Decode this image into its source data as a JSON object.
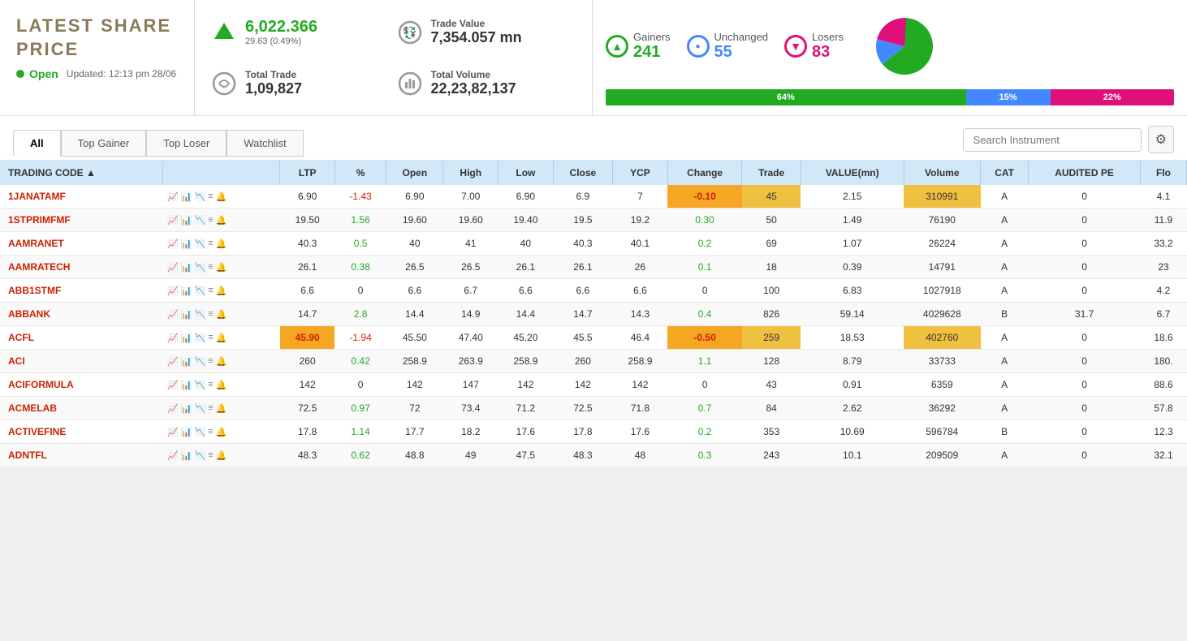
{
  "header": {
    "title": "LATEST SHARE PRICE",
    "status": "Open",
    "updated": "Updated: 12:13 pm 28/06"
  },
  "index": {
    "value": "6,022.366",
    "change": "29.63 (0.49%)",
    "trade_label": "Total Trade",
    "trade_value": "1,09,827",
    "trade_value_label": "Trade Value",
    "trade_value_mn": "7,354.057 mn",
    "volume_label": "Total Volume",
    "volume_value": "22,23,82,137"
  },
  "stats": {
    "gainers_label": "Gainers",
    "gainers_value": "241",
    "unchanged_label": "Unchanged",
    "unchanged_value": "55",
    "losers_label": "Losers",
    "losers_value": "83",
    "bar_green_pct": "64%",
    "bar_green_width": "64",
    "bar_blue_pct": "15%",
    "bar_blue_width": "15",
    "bar_pink_pct": "22%",
    "bar_pink_width": "22"
  },
  "tabs": [
    "All",
    "Top Gainer",
    "Top Loser",
    "Watchlist"
  ],
  "active_tab": 0,
  "search_placeholder": "Search Instrument",
  "table": {
    "columns": [
      "TRADING CODE ▲",
      "",
      "LTP",
      "%",
      "Open",
      "High",
      "Low",
      "Close",
      "YCP",
      "Change",
      "Trade",
      "VALUE(mn)",
      "Volume",
      "CAT",
      "AUDITED PE",
      "Flo"
    ],
    "rows": [
      {
        "code": "1JANATAMF",
        "ltp": "6.90",
        "pct": "-1.43",
        "open": "6.90",
        "high": "7.00",
        "low": "6.90",
        "close": "6.9",
        "ycp": "7",
        "change": "-0.10",
        "trade": "45",
        "value": "2.15",
        "volume": "310991",
        "cat": "A",
        "pe": "0",
        "flo": "4.1",
        "pct_neg": true,
        "change_neg": true,
        "highlight_change": true,
        "highlight_trade": true,
        "highlight_volume": true
      },
      {
        "code": "1STPRIMFMF",
        "ltp": "19.50",
        "pct": "1.56",
        "open": "19.60",
        "high": "19.60",
        "low": "19.40",
        "close": "19.5",
        "ycp": "19.2",
        "change": "0.30",
        "trade": "50",
        "value": "1.49",
        "volume": "76190",
        "cat": "A",
        "pe": "0",
        "flo": "11.9",
        "pct_neg": false,
        "change_neg": false
      },
      {
        "code": "AAMRANET",
        "ltp": "40.3",
        "pct": "0.5",
        "open": "40",
        "high": "41",
        "low": "40",
        "close": "40.3",
        "ycp": "40.1",
        "change": "0.2",
        "trade": "69",
        "value": "1.07",
        "volume": "26224",
        "cat": "A",
        "pe": "0",
        "flo": "33.2",
        "pct_neg": false,
        "change_neg": false
      },
      {
        "code": "AAMRATECH",
        "ltp": "26.1",
        "pct": "0.38",
        "open": "26.5",
        "high": "26.5",
        "low": "26.1",
        "close": "26.1",
        "ycp": "26",
        "change": "0.1",
        "trade": "18",
        "value": "0.39",
        "volume": "14791",
        "cat": "A",
        "pe": "0",
        "flo": "23",
        "pct_neg": false,
        "change_neg": false
      },
      {
        "code": "ABB1STMF",
        "ltp": "6.6",
        "pct": "0",
        "open": "6.6",
        "high": "6.7",
        "low": "6.6",
        "close": "6.6",
        "ycp": "6.6",
        "change": "0",
        "trade": "100",
        "value": "6.83",
        "volume": "1027918",
        "cat": "A",
        "pe": "0",
        "flo": "4.2",
        "pct_neg": false,
        "change_neg": false
      },
      {
        "code": "ABBANK",
        "ltp": "14.7",
        "pct": "2.8",
        "open": "14.4",
        "high": "14.9",
        "low": "14.4",
        "close": "14.7",
        "ycp": "14.3",
        "change": "0.4",
        "trade": "826",
        "value": "59.14",
        "volume": "4029628",
        "cat": "B",
        "pe": "31.7",
        "flo": "6.7",
        "pct_neg": false,
        "change_neg": false
      },
      {
        "code": "ACFL",
        "ltp": "45.90",
        "pct": "-1.94",
        "open": "45.50",
        "high": "47.40",
        "low": "45.20",
        "close": "45.5",
        "ycp": "46.4",
        "change": "-0.50",
        "trade": "259",
        "value": "18.53",
        "volume": "402760",
        "cat": "A",
        "pe": "0",
        "flo": "18.6",
        "pct_neg": true,
        "change_neg": true,
        "highlight_ltp": true,
        "highlight_change": true,
        "highlight_trade": true,
        "highlight_volume": true
      },
      {
        "code": "ACI",
        "ltp": "260",
        "pct": "0.42",
        "open": "258.9",
        "high": "263.9",
        "low": "258.9",
        "close": "260",
        "ycp": "258.9",
        "change": "1.1",
        "trade": "128",
        "value": "8.79",
        "volume": "33733",
        "cat": "A",
        "pe": "0",
        "flo": "180.",
        "pct_neg": false,
        "change_neg": false
      },
      {
        "code": "ACIFORMULA",
        "ltp": "142",
        "pct": "0",
        "open": "142",
        "high": "147",
        "low": "142",
        "close": "142",
        "ycp": "142",
        "change": "0",
        "trade": "43",
        "value": "0.91",
        "volume": "6359",
        "cat": "A",
        "pe": "0",
        "flo": "88.6",
        "pct_neg": false,
        "change_neg": false
      },
      {
        "code": "ACMELAB",
        "ltp": "72.5",
        "pct": "0.97",
        "open": "72",
        "high": "73.4",
        "low": "71.2",
        "close": "72.5",
        "ycp": "71.8",
        "change": "0.7",
        "trade": "84",
        "value": "2.62",
        "volume": "36292",
        "cat": "A",
        "pe": "0",
        "flo": "57.8",
        "pct_neg": false,
        "change_neg": false
      },
      {
        "code": "ACTIVEFINE",
        "ltp": "17.8",
        "pct": "1.14",
        "open": "17.7",
        "high": "18.2",
        "low": "17.6",
        "close": "17.8",
        "ycp": "17.6",
        "change": "0.2",
        "trade": "353",
        "value": "10.69",
        "volume": "596784",
        "cat": "B",
        "pe": "0",
        "flo": "12.3",
        "pct_neg": false,
        "change_neg": false
      },
      {
        "code": "ADNTFL",
        "ltp": "48.3",
        "pct": "0.62",
        "open": "48.8",
        "high": "49",
        "low": "47.5",
        "close": "48.3",
        "ycp": "48",
        "change": "0.3",
        "trade": "243",
        "value": "10.1",
        "volume": "209509",
        "cat": "A",
        "pe": "0",
        "flo": "32.1",
        "pct_neg": false,
        "change_neg": false
      }
    ]
  }
}
